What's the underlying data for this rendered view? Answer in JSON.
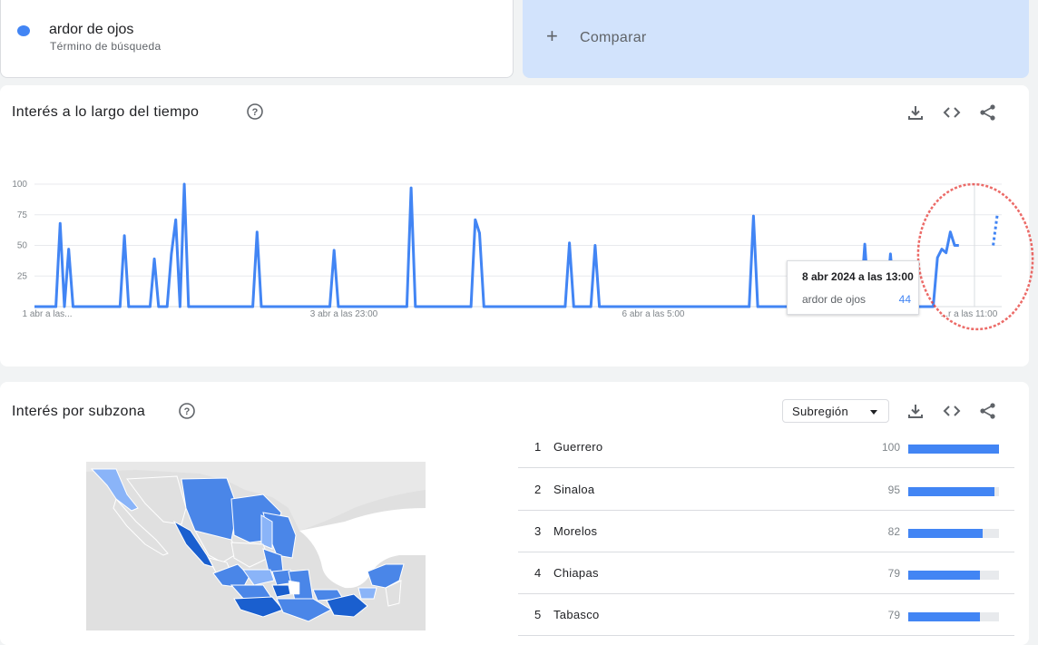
{
  "term": {
    "name": "ardor de ojos",
    "type": "Término de búsqueda",
    "color": "#4285f4"
  },
  "compare": {
    "label": "Comparar",
    "icon": "plus-icon"
  },
  "time_section": {
    "title": "Interés a lo largo del tiempo",
    "icons": [
      "help-icon",
      "download-icon",
      "embed-code-icon",
      "share-icon"
    ]
  },
  "tooltip": {
    "date": "8 abr 2024 a las 13:00",
    "series": "ardor de ojos",
    "value": "44"
  },
  "chart_data": {
    "type": "line",
    "ylim": [
      0,
      100
    ],
    "yticks": [
      "100",
      "75",
      "50",
      "25"
    ],
    "xtick_labels": [
      "1 abr a las...",
      "3 abr a las 23:00",
      "6 abr a las 5:00",
      "...r a las 11:00"
    ],
    "grid": true,
    "series": [
      {
        "color": "#4285f4",
        "values": [
          0,
          0,
          0,
          0,
          0,
          0,
          68,
          0,
          47,
          0,
          0,
          0,
          0,
          0,
          0,
          0,
          0,
          0,
          0,
          0,
          0,
          58,
          0,
          0,
          0,
          0,
          0,
          0,
          39,
          0,
          0,
          0,
          43,
          71,
          0,
          100,
          0,
          0,
          0,
          0,
          0,
          0,
          0,
          0,
          0,
          0,
          0,
          0,
          0,
          0,
          0,
          0,
          61,
          0,
          0,
          0,
          0,
          0,
          0,
          0,
          0,
          0,
          0,
          0,
          0,
          0,
          0,
          0,
          0,
          0,
          46,
          0,
          0,
          0,
          0,
          0,
          0,
          0,
          0,
          0,
          0,
          0,
          0,
          0,
          0,
          0,
          0,
          0,
          97,
          0,
          0,
          0,
          0,
          0,
          0,
          0,
          0,
          0,
          0,
          0,
          0,
          0,
          0,
          71,
          60,
          0,
          0,
          0,
          0,
          0,
          0,
          0,
          0,
          0,
          0,
          0,
          0,
          0,
          0,
          0,
          0,
          0,
          0,
          0,
          0,
          52,
          0,
          0,
          0,
          0,
          0,
          50,
          0,
          0,
          0,
          0,
          0,
          0,
          0,
          0,
          0,
          0,
          0,
          0,
          0,
          0,
          0,
          0,
          0,
          0,
          0,
          0,
          0,
          0,
          0,
          0,
          0,
          0,
          0,
          0,
          0,
          0,
          0,
          0,
          0,
          0,
          0,
          0,
          74,
          0,
          0,
          0,
          0,
          0,
          0,
          0,
          0,
          0,
          0,
          0,
          0,
          0,
          0,
          0,
          0,
          0,
          0,
          0,
          0,
          0,
          0,
          0,
          0,
          0,
          51,
          0,
          0,
          0,
          0,
          0,
          43,
          0,
          0,
          0,
          0,
          0,
          0,
          0,
          0,
          0,
          0,
          40,
          47,
          44,
          61,
          50,
          50
        ]
      },
      {
        "color": "#4285f4",
        "style": "dotted",
        "partial": true,
        "start_index": 224,
        "values": [
          50,
          76
        ]
      }
    ],
    "annotation": "red hand-drawn circle around most recent data"
  },
  "region_section": {
    "title": "Interés por subzona",
    "select_value": "Subregión",
    "icons": [
      "help-icon",
      "download-icon",
      "embed-code-icon",
      "share-icon"
    ],
    "ranking": [
      {
        "rank": "1",
        "name": "Guerrero",
        "value": "100",
        "pct": 100
      },
      {
        "rank": "2",
        "name": "Sinaloa",
        "value": "95",
        "pct": 95
      },
      {
        "rank": "3",
        "name": "Morelos",
        "value": "82",
        "pct": 82
      },
      {
        "rank": "4",
        "name": "Chiapas",
        "value": "79",
        "pct": 79
      },
      {
        "rank": "5",
        "name": "Tabasco",
        "value": "79",
        "pct": 79
      }
    ],
    "map_colors": {
      "high": "#1a5fcf",
      "mid": "#4a86e8",
      "low": "#8ab4f8",
      "none": "#dadce0",
      "land": "#e0e0e0"
    }
  }
}
